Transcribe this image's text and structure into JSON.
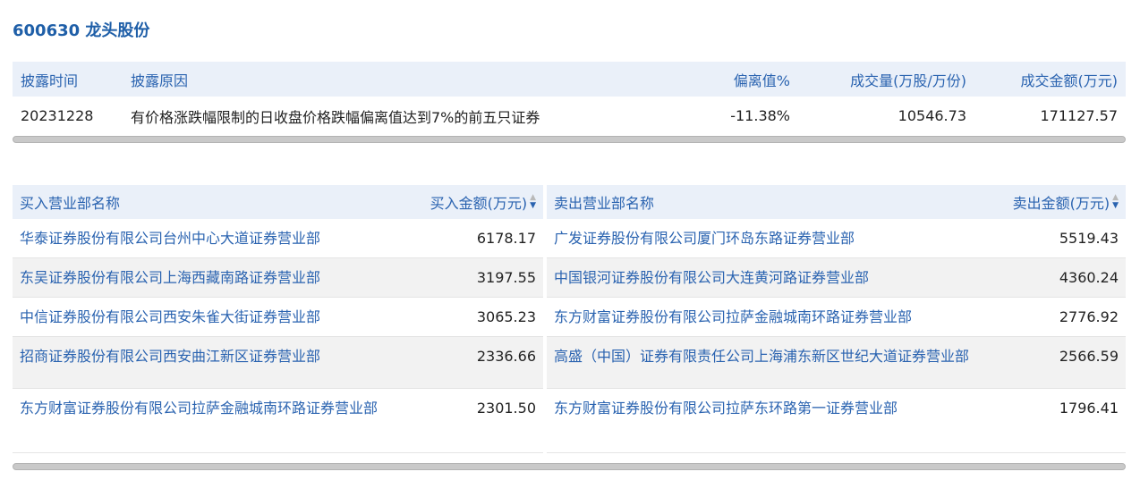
{
  "header": {
    "title": "600630 龙头股份"
  },
  "disclosure": {
    "columns": {
      "time": "披露时间",
      "reason": "披露原因",
      "deviation": "偏离值%",
      "volume": "成交量(万股/万份)",
      "amount": "成交金额(万元)"
    },
    "rows": [
      {
        "time": "20231228",
        "reason": "有价格涨跌幅限制的日收盘价格跌幅偏离值达到7%的前五只证券",
        "deviation": "-11.38%",
        "volume": "10546.73",
        "amount": "171127.57"
      }
    ]
  },
  "buy": {
    "header_name": "买入营业部名称",
    "header_amount": "买入金额(万元)",
    "sort_icon": "sort-triangle-icon",
    "rows": [
      {
        "name": "华泰证券股份有限公司台州中心大道证券营业部",
        "amount": "6178.17"
      },
      {
        "name": "东吴证券股份有限公司上海西藏南路证券营业部",
        "amount": "3197.55"
      },
      {
        "name": "中信证券股份有限公司西安朱雀大街证券营业部",
        "amount": "3065.23"
      },
      {
        "name": "招商证券股份有限公司西安曲江新区证券营业部",
        "amount": "2336.66"
      },
      {
        "name": "东方财富证券股份有限公司拉萨金融城南环路证券营业部",
        "amount": "2301.50"
      }
    ]
  },
  "sell": {
    "header_name": "卖出营业部名称",
    "header_amount": "卖出金额(万元)",
    "sort_icon": "sort-triangle-icon",
    "rows": [
      {
        "name": "广发证券股份有限公司厦门环岛东路证券营业部",
        "amount": "5519.43"
      },
      {
        "name": "中国银河证券股份有限公司大连黄河路证券营业部",
        "amount": "4360.24"
      },
      {
        "name": "东方财富证券股份有限公司拉萨金融城南环路证券营业部",
        "amount": "2776.92"
      },
      {
        "name": "高盛（中国）证券有限责任公司上海浦东新区世纪大道证券营业部",
        "amount": "2566.59"
      },
      {
        "name": "东方财富证券股份有限公司拉萨东环路第一证券营业部",
        "amount": "1796.41"
      }
    ]
  },
  "colors": {
    "accent": "#2a63b0",
    "title": "#1f5fa8",
    "header_bg": "#eaf0f9",
    "stripe_bg": "#f2f2f2"
  }
}
